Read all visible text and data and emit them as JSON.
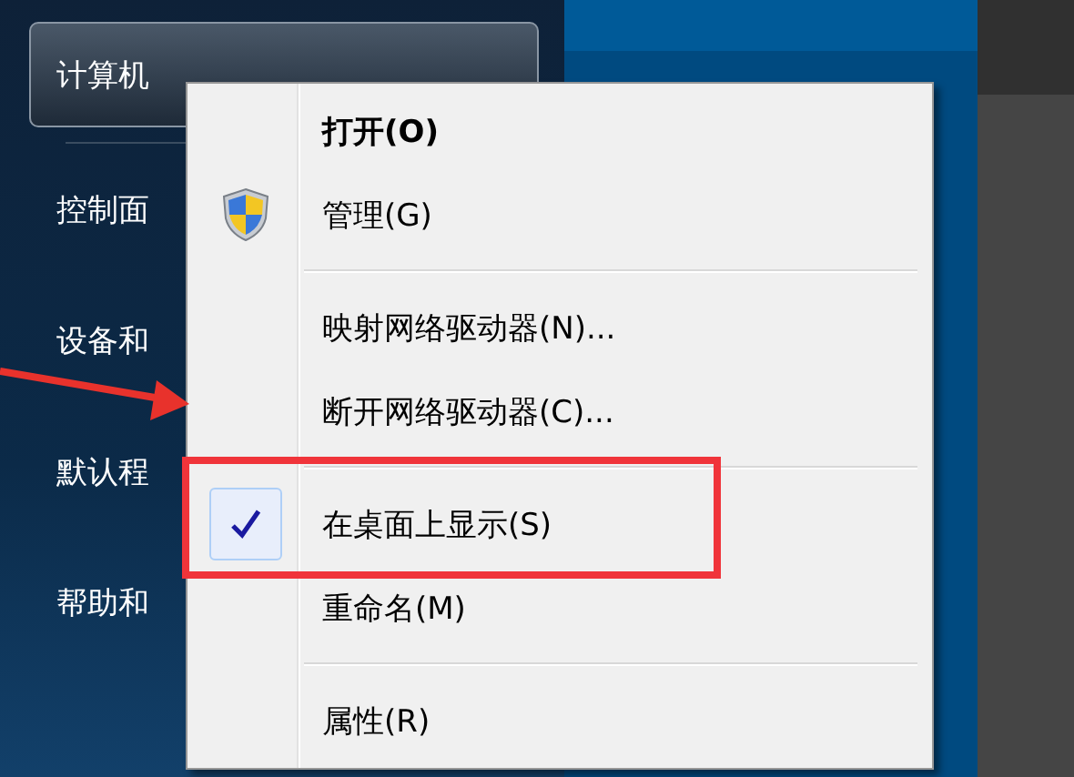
{
  "start_menu": {
    "items": [
      {
        "label": "计算机",
        "selected": true
      },
      {
        "label": "控制面",
        "selected": false
      },
      {
        "label": "设备和",
        "selected": false
      },
      {
        "label": "默认程",
        "selected": false
      },
      {
        "label": "帮助和",
        "selected": false
      }
    ]
  },
  "context_menu": {
    "items": [
      {
        "kind": "item",
        "label": "打开(O)",
        "default": true,
        "shield": false,
        "checked": false
      },
      {
        "kind": "item",
        "label": "管理(G)",
        "default": false,
        "shield": true,
        "checked": false
      },
      {
        "kind": "separator"
      },
      {
        "kind": "item",
        "label": "映射网络驱动器(N)...",
        "default": false,
        "shield": false,
        "checked": false
      },
      {
        "kind": "item",
        "label": "断开网络驱动器(C)...",
        "default": false,
        "shield": false,
        "checked": false
      },
      {
        "kind": "separator"
      },
      {
        "kind": "item",
        "label": "在桌面上显示(S)",
        "default": false,
        "shield": false,
        "checked": true
      },
      {
        "kind": "item",
        "label": "重命名(M)",
        "default": false,
        "shield": false,
        "checked": false
      },
      {
        "kind": "separator"
      },
      {
        "kind": "item",
        "label": "属性(R)",
        "default": false,
        "shield": false,
        "checked": false
      }
    ]
  }
}
